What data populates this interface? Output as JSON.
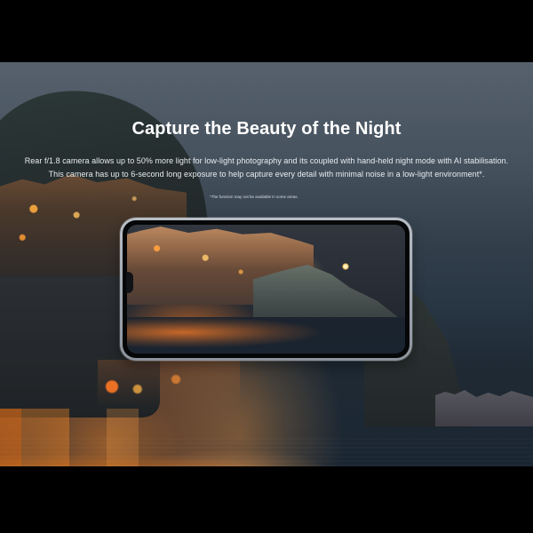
{
  "hero": {
    "headline": "Capture the Beauty of the Night",
    "description_line_1": "Rear f/1.8 camera allows up to 50% more light for low-light photography and its coupled with hand-held night mode with AI stabilisation.",
    "description_line_2": "This camera has up to 6-second long exposure to help capture every detail with minimal noise in a low-light environment*.",
    "footnote": "*The function may not be available in some areas."
  },
  "colors": {
    "background": "#000000",
    "text_primary": "#ffffff",
    "text_secondary": "#e8ecef",
    "phone_frame": "#a0a7b0"
  },
  "icons": {
    "camera_notch": "camera-notch-icon"
  }
}
